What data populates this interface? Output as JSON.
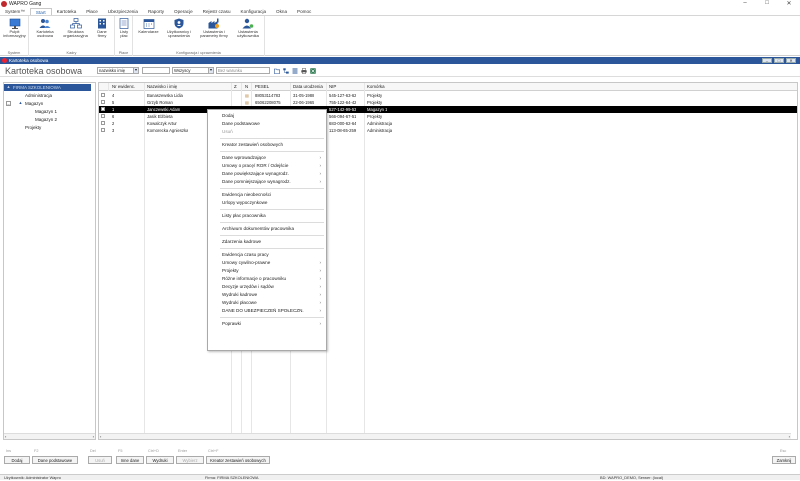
{
  "window": {
    "title": "WAPRO Gang",
    "minimize": "–",
    "maximize": "□",
    "close": "✕"
  },
  "menu": [
    "System™",
    "Start",
    "Kartoteka",
    "Płace",
    "Ubezpieczenia",
    "Raporty",
    "Operacje",
    "Rejestr czasu",
    "Konfiguracja",
    "Okna",
    "Pomoc"
  ],
  "ribbon": {
    "groups": [
      {
        "label": "System",
        "buttons": [
          "Pulpit\ninformacyjny"
        ]
      },
      {
        "label": "Kadry",
        "buttons": [
          "Kartoteka\nosobowa",
          "Struktura\norganizacyjna",
          "Dane\nfirmy"
        ]
      },
      {
        "label": "Płace",
        "buttons": [
          "Listy\npłac"
        ]
      },
      {
        "label": "Konfiguracja i uprawnienia",
        "buttons": [
          "Kalendarze",
          "Użytkownicy i\nuprawnienia",
          "Ustawienia i\nparametry firmy",
          "Ustawienia\nużytkownika"
        ]
      }
    ],
    "icons": [
      "monitor-icon",
      "users-icon",
      "org-chart-icon",
      "building-icon",
      "payroll-list-icon",
      "calendar-icon",
      "shield-user-icon",
      "factory-settings-icon",
      "user-settings-icon"
    ]
  },
  "panel": {
    "title": "Kartoteka osobowa",
    "heading": "Kartoteka osobowa"
  },
  "filters": {
    "sort_by": "nazwisko imię",
    "status": "Wszyscy",
    "search_placeholder": "Bez warunku"
  },
  "tree": [
    {
      "label": "FIRMA SZKOLENIOWA",
      "level": 0,
      "toggle": "▲",
      "selected": true
    },
    {
      "label": "Administracja",
      "level": 1,
      "toggle": "",
      "selected": false
    },
    {
      "label": "Magazyn",
      "level": 1,
      "toggle": "▲",
      "selected": false
    },
    {
      "label": "Magazyn 1",
      "level": 2,
      "toggle": "",
      "selected": false
    },
    {
      "label": "Magazyn 2",
      "level": 2,
      "toggle": "",
      "selected": false
    },
    {
      "label": "Projekty",
      "level": 1,
      "toggle": "",
      "selected": false
    }
  ],
  "grid": {
    "columns": [
      "Nr ewidenc.",
      "Nazwisko i imię",
      "Z",
      "N",
      "PESEL",
      "Data urodzenia",
      "NIP",
      "Komórka"
    ],
    "rows": [
      {
        "nr": "4",
        "name": "Banaszewska Lidia",
        "pesel": "88053114783",
        "dob": "31-05-1988",
        "nip": "545-127-63-62",
        "dept": "Projekty",
        "selected": false
      },
      {
        "nr": "5",
        "name": "Grzyb Roman",
        "pesel": "65062208075",
        "dob": "22-06-1965",
        "nip": "755-122-64-42",
        "dept": "Projekty",
        "selected": false
      },
      {
        "nr": "1",
        "name": "Janczewski Adam",
        "pesel": "",
        "dob": "",
        "nip": "527-142-99-53",
        "dept": "Magazyn 1",
        "selected": true
      },
      {
        "nr": "6",
        "name": "Jasik Elżbieta",
        "pesel": "",
        "dob": "",
        "nip": "566-094-67-51",
        "dept": "Projekty",
        "selected": false
      },
      {
        "nr": "2",
        "name": "Kowalczyk Artur",
        "pesel": "",
        "dob": "",
        "nip": "683-000-62-64",
        "dept": "Administracja",
        "selected": false
      },
      {
        "nr": "3",
        "name": "Komorecka Agnieszka",
        "pesel": "",
        "dob": "",
        "nip": "113-08-65-259",
        "dept": "Administracja",
        "selected": false
      }
    ]
  },
  "context_menu": [
    {
      "label": "Dodaj",
      "arrow": "",
      "disabled": false
    },
    {
      "label": "Dane podstawowe",
      "arrow": "",
      "disabled": false
    },
    {
      "label": "Usuń",
      "arrow": "",
      "disabled": true
    },
    {
      "sep": true
    },
    {
      "label": "Kreator zestawień osobowych",
      "arrow": "",
      "disabled": false
    },
    {
      "sep": true
    },
    {
      "label": "Dane wprowadzające",
      "arrow": "›",
      "disabled": false
    },
    {
      "label": "Umowy o pracę/ ROR / Odejście",
      "arrow": "›",
      "disabled": false
    },
    {
      "label": "Dane powiększające wynagrodz.",
      "arrow": "›",
      "disabled": false
    },
    {
      "label": "Dane pomniejszające wynagrodz.",
      "arrow": "›",
      "disabled": false
    },
    {
      "sep": true
    },
    {
      "label": "Ewidencja nieobecności",
      "arrow": "",
      "disabled": false
    },
    {
      "label": "Urlopy wypoczynkowe",
      "arrow": "",
      "disabled": false
    },
    {
      "sep": true
    },
    {
      "label": "Listy płac pracownika",
      "arrow": "",
      "disabled": false
    },
    {
      "sep": true
    },
    {
      "label": "Archiwum dokumentów pracownika",
      "arrow": "",
      "disabled": false
    },
    {
      "sep": true
    },
    {
      "label": "Zdarzenia kadrowe",
      "arrow": "",
      "disabled": false
    },
    {
      "sep": true
    },
    {
      "label": "Ewidencja czasu pracy",
      "arrow": "",
      "disabled": false
    },
    {
      "label": "Umowy cywilno-prawne",
      "arrow": "›",
      "disabled": false
    },
    {
      "label": "Projekty",
      "arrow": "›",
      "disabled": false
    },
    {
      "label": "Różne informacje o pracowniku",
      "arrow": "›",
      "disabled": false
    },
    {
      "label": "Decyzje urzędów i sądów",
      "arrow": "›",
      "disabled": false
    },
    {
      "label": "Wydruki kadrowe",
      "arrow": "›",
      "disabled": false
    },
    {
      "label": "Wydruki płacowe",
      "arrow": "›",
      "disabled": false
    },
    {
      "label": "DANE DO UBEZPIECZEŃ SPOŁECZN.",
      "arrow": "›",
      "disabled": false
    },
    {
      "sep": true
    },
    {
      "label": "Poprawki",
      "arrow": "›",
      "disabled": false
    }
  ],
  "bottom_buttons": [
    {
      "key": "Ins",
      "label": "Dodaj",
      "disabled": false
    },
    {
      "key": "F2",
      "label": "Dane podstawowe",
      "disabled": false
    },
    {
      "key": "Del",
      "label": "Usuń",
      "disabled": true
    },
    {
      "key": "F5",
      "label": "Inne dane",
      "disabled": false
    },
    {
      "key": "Ctrl+D",
      "label": "Wydruki",
      "disabled": false
    },
    {
      "key": "Enter",
      "label": "Wybierz",
      "disabled": true
    },
    {
      "key": "Ctrl+F",
      "label": "Kreator zestawień osobowych",
      "disabled": false
    },
    {
      "key": "Esc",
      "label": "Zamknij",
      "disabled": false
    }
  ],
  "status": {
    "user": "Użytkownik: Administrator Wapro",
    "company": "Firma: FIRMA SZKOLENIOWA",
    "db": "BD: WAPRO_DEMO, Serwer: (local)"
  }
}
